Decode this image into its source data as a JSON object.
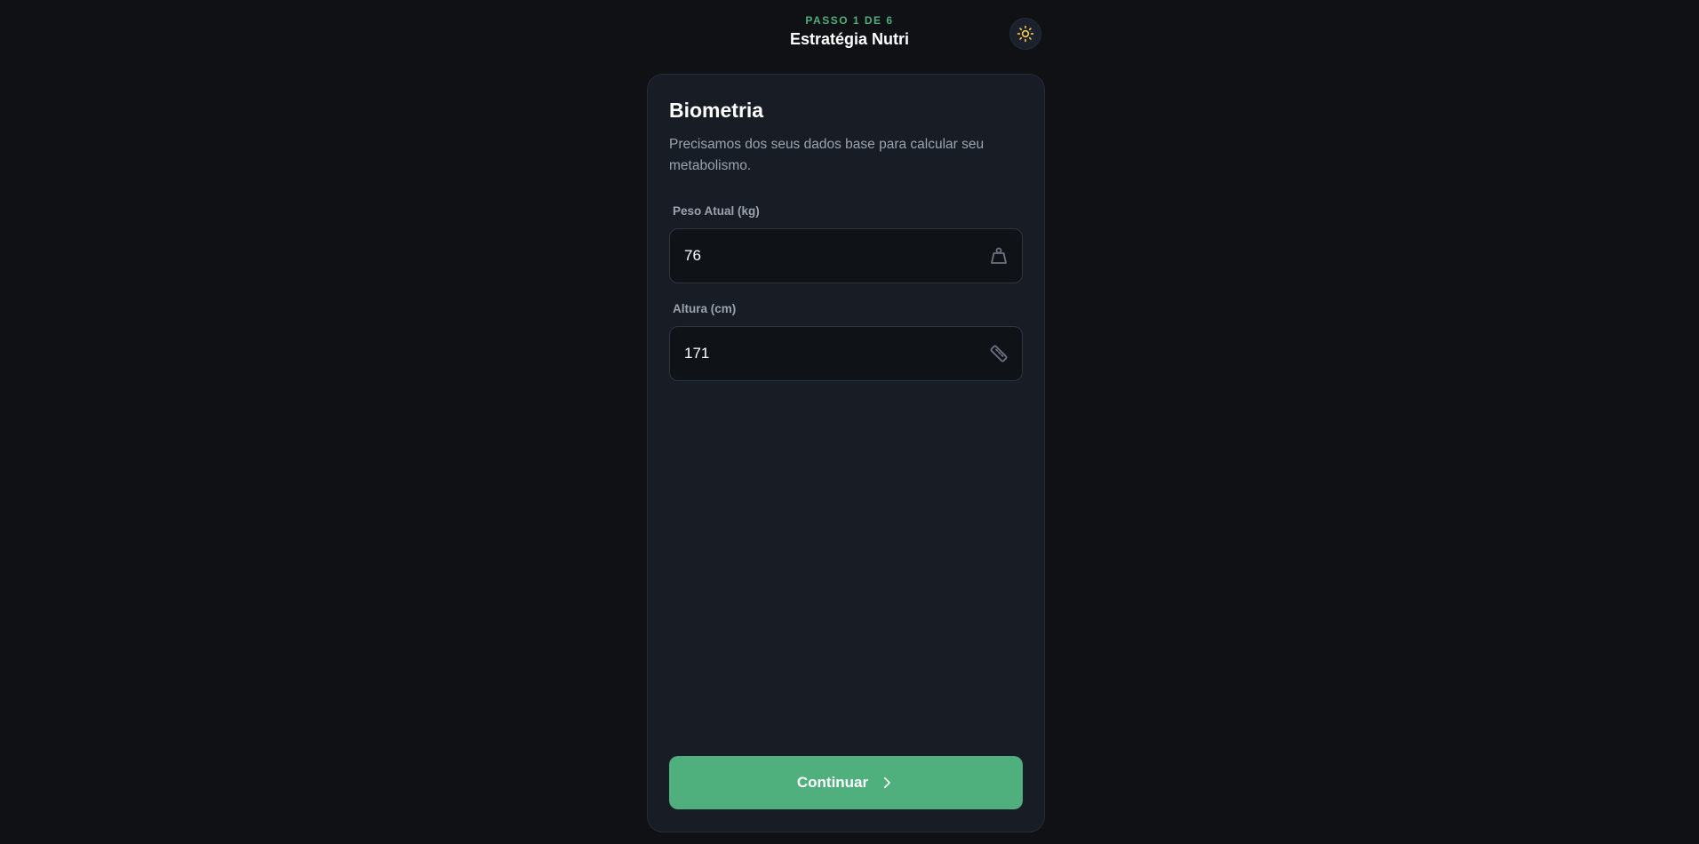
{
  "header": {
    "step": "PASSO 1 DE 6",
    "title": "Estratégia Nutri",
    "theme_icon": "sun-icon"
  },
  "card": {
    "title": "Biometria",
    "subtitle": "Precisamos dos seus dados base para calcular seu metabolismo.",
    "fields": [
      {
        "label": "Peso Atual (kg)",
        "value": "76",
        "icon": "weight-icon"
      },
      {
        "label": "Altura (cm)",
        "value": "171",
        "icon": "ruler-icon"
      }
    ],
    "continue_label": "Continuar",
    "continue_icon": "chevron-right-icon"
  },
  "colors": {
    "accent": "#4faf7d",
    "step_text": "#4fae7c",
    "background": "#0f1115",
    "card": "#181d25",
    "sun": "#f5c451"
  }
}
